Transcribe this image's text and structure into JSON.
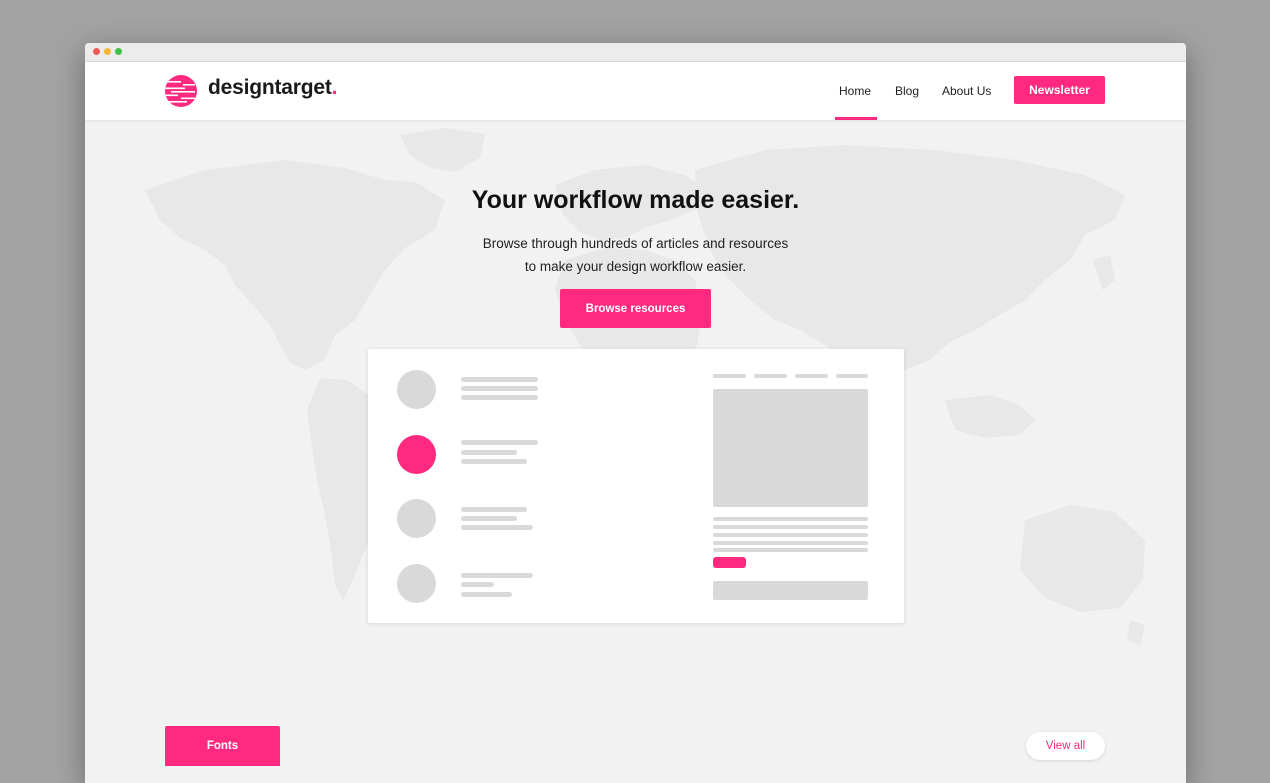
{
  "window": {
    "controls": [
      "close",
      "minimize",
      "maximize"
    ]
  },
  "brand": {
    "name": "designtarget",
    "dot": ".",
    "accent_color": "#ff2a7f",
    "logo_icon": "striped-circle-logo"
  },
  "nav": {
    "items": [
      {
        "label": "Home",
        "active": true
      },
      {
        "label": "Blog",
        "active": false
      },
      {
        "label": "About Us",
        "active": false
      }
    ],
    "cta_label": "Newsletter"
  },
  "hero": {
    "title": "Your workflow made easier.",
    "subtitle_line1": "Browse through hundreds of articles and resources",
    "subtitle_line2": "to make your design workflow easier.",
    "button_label": "Browse resources",
    "background": "world-map"
  },
  "illustration": {
    "type": "wireframe-card",
    "list_items": 4,
    "highlighted_item": 2
  },
  "section": {
    "tab_label": "Fonts",
    "view_all_label": "View all"
  }
}
